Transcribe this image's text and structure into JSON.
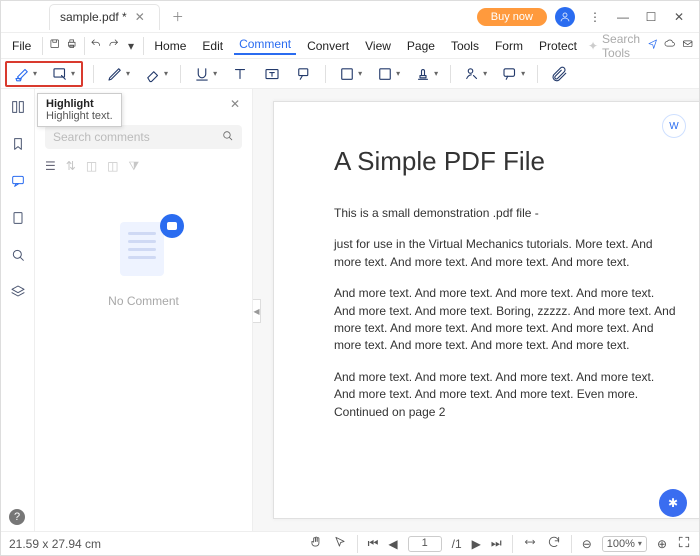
{
  "title": {
    "tab": "sample.pdf *"
  },
  "header": {
    "buy": "Buy now"
  },
  "menus": {
    "file": "File",
    "home": "Home",
    "edit": "Edit",
    "comment": "Comment",
    "convert": "Convert",
    "view": "View",
    "page": "Page",
    "tools": "Tools",
    "form": "Form",
    "protect": "Protect",
    "search_ph": "Search Tools"
  },
  "tooltip": {
    "title": "Highlight",
    "body": "Highlight text."
  },
  "sidebar": {
    "search_ph": "Search comments",
    "empty": "No Comment"
  },
  "doc": {
    "h1": "A Simple PDF File",
    "p1": "This is a small demonstration .pdf file -",
    "p2": "just for use in the Virtual Mechanics tutorials. More text. And more text. And more text. And more text. And more text.",
    "p3": "And more text. And more text. And more text. And more text. And more text. And more text. Boring, zzzzz. And more text. And more text. And more text. And more text. And more text. And more text. And more text. And more text. And more text.",
    "p4": "And more text. And more text. And more text. And more text. And more text. And more text. And more text. Even more. Continued on page 2"
  },
  "status": {
    "dims": "21.59 x 27.94 cm",
    "page": "1",
    "total": "/1",
    "zoom": "100%"
  }
}
